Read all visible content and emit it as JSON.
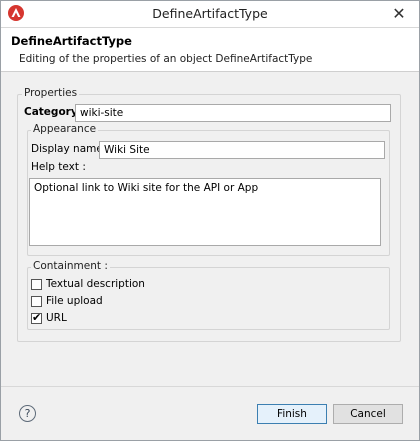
{
  "window": {
    "title": "DefineArtifactType",
    "close_glyph": "✕",
    "icon": "app-logo-icon"
  },
  "banner": {
    "title": "DefineArtifactType",
    "description": "Editing of the properties of an object DefineArtifactType"
  },
  "properties": {
    "group_label": "Properties",
    "category_label": "Category :",
    "category_value": "wiki-site"
  },
  "appearance": {
    "group_label": "Appearance",
    "display_name_label": "Display name :",
    "display_name_value": "Wiki Site",
    "help_text_label": "Help text :",
    "help_text_value": "Optional link to Wiki site for the API or App"
  },
  "containment": {
    "group_label": "Containment :",
    "options": [
      {
        "label": "Textual description",
        "checked": false
      },
      {
        "label": "File upload",
        "checked": false
      },
      {
        "label": "URL",
        "checked": true
      }
    ],
    "check_glyph": "✔"
  },
  "footer": {
    "help_glyph": "?",
    "finish_label": "Finish",
    "cancel_label": "Cancel"
  },
  "colors": {
    "app_icon": "#d6362f",
    "default_button_border": "#3c7fb1"
  }
}
